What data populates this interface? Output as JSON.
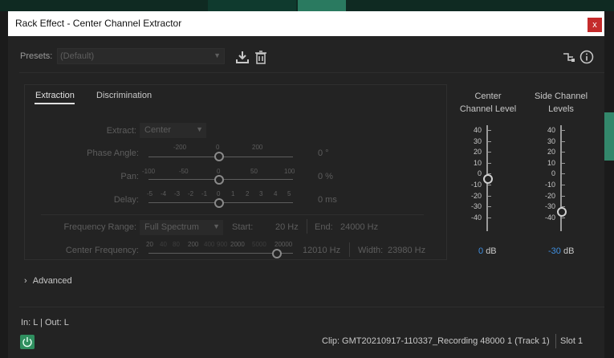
{
  "window": {
    "title": "Rack Effect - Center Channel Extractor",
    "close_glyph": "x"
  },
  "presets": {
    "label": "Presets:",
    "value": "(Default)"
  },
  "tabs": [
    "Extraction",
    "Discrimination"
  ],
  "extract": {
    "label": "Extract:",
    "value": "Center"
  },
  "phase_angle": {
    "label": "Phase Angle:",
    "ticks": [
      "-200",
      "0",
      "200"
    ],
    "value": "0 °"
  },
  "pan": {
    "label": "Pan:",
    "ticks": [
      "-100",
      "-50",
      "0",
      "50",
      "100"
    ],
    "value": "0 %"
  },
  "delay": {
    "label": "Delay:",
    "ticks": [
      "-5",
      "-4",
      "-3",
      "-2",
      "-1",
      "0",
      "1",
      "2",
      "3",
      "4",
      "5"
    ],
    "value": "0 ms"
  },
  "frequency_range": {
    "label": "Frequency Range:",
    "value": "Full Spectrum",
    "start_label": "Start:",
    "start_value": "20 Hz",
    "end_label": "End:",
    "end_value": "24000 Hz"
  },
  "center_frequency": {
    "label": "Center Frequency:",
    "ticks": [
      "20",
      "40",
      "80",
      "200",
      "400",
      "900",
      "2000",
      "5000",
      "20000"
    ],
    "value": "12010 Hz",
    "width_label": "Width:",
    "width_value": "23980 Hz"
  },
  "meters": {
    "center": {
      "title_line1": "Center",
      "title_line2": "Channel Level",
      "value": "0",
      "unit": "dB"
    },
    "side": {
      "title_line1": "Side Channel",
      "title_line2": "Levels",
      "value": "-30",
      "unit": "dB"
    },
    "scale": [
      "40",
      "30",
      "20",
      "10",
      "0",
      "-10",
      "-20",
      "-30",
      "-40"
    ]
  },
  "advanced": {
    "label": "Advanced",
    "chevron": "›"
  },
  "footer": {
    "inout": "In: L | Out: L",
    "clip": "Clip: GMT20210917-110337_Recording 48000 1 (Track 1)",
    "slot": "Slot 1"
  },
  "colors": {
    "accent_blue": "#3f8fe0",
    "power_green": "#2f8f5f",
    "close_red": "#c42b2b"
  }
}
